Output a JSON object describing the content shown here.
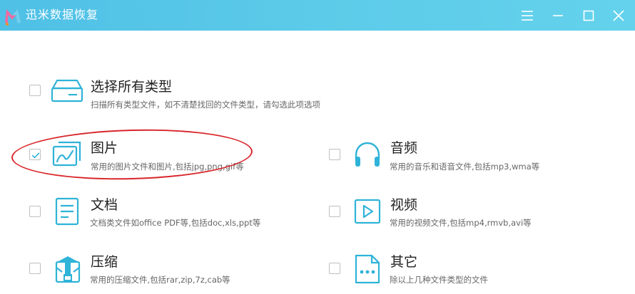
{
  "window": {
    "title": "迅米数据恢复",
    "controls": [
      {
        "name": "menu-button",
        "icon": "hamburger-icon"
      },
      {
        "name": "minimize-button",
        "icon": "minimize-icon"
      },
      {
        "name": "maximize-button",
        "icon": "maximize-icon"
      },
      {
        "name": "close-button",
        "icon": "close-icon"
      }
    ]
  },
  "options": {
    "all": {
      "title": "选择所有类型",
      "desc": "扫描所有类型文件，如不清楚找回的文件类型，请勾选此项选项",
      "checked": false,
      "icon": "hard-drive-icon"
    },
    "images": {
      "title": "图片",
      "desc": "常用的图片文件和图片,包括jpg,png,gif等",
      "checked": true,
      "icon": "image-icon"
    },
    "audio": {
      "title": "音频",
      "desc": "常用的音乐和语音文件,包括mp3,wma等",
      "checked": false,
      "icon": "headphones-icon"
    },
    "documents": {
      "title": "文档",
      "desc": "文档类文件如office PDF等,包括doc,xls,ppt等",
      "checked": false,
      "icon": "document-icon"
    },
    "video": {
      "title": "视频",
      "desc": "常用的视频文件,包括mp4,rmvb,avi等",
      "checked": false,
      "icon": "video-play-icon"
    },
    "archives": {
      "title": "压缩",
      "desc": "常用的压缩文件,包括rar,zip,7z,cab等",
      "checked": false,
      "icon": "archive-icon"
    },
    "other": {
      "title": "其它",
      "desc": "除以上几种文件类型的文件",
      "checked": false,
      "icon": "file-more-icon"
    }
  },
  "colors": {
    "accent": "#2fb3d8",
    "titlebar": "#55c6e8",
    "annotation": "#d9262b"
  }
}
